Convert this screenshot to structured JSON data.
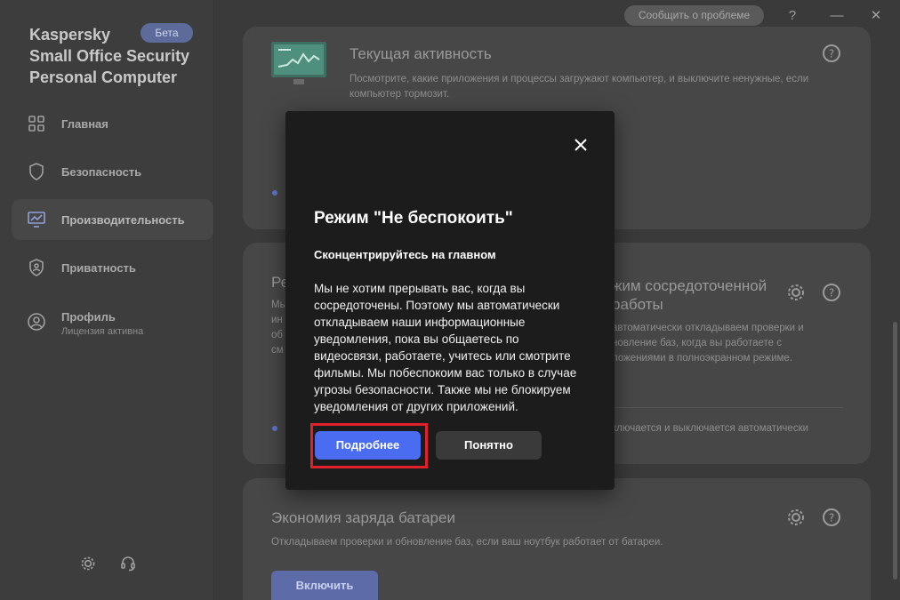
{
  "app": {
    "title": "Kaspersky\nSmall Office Security\nPersonal Computer",
    "badge": "Бета"
  },
  "sidebar": {
    "items": [
      {
        "label": "Главная",
        "icon": "home-grid-icon"
      },
      {
        "label": "Безопасность",
        "icon": "shield-icon"
      },
      {
        "label": "Производительность",
        "icon": "monitor-performance-icon"
      },
      {
        "label": "Приватность",
        "icon": "privacy-shield-icon"
      },
      {
        "label": "Профиль",
        "sublabel": "Лицензия активна",
        "icon": "profile-icon"
      }
    ],
    "bottom_icons": [
      "gear-icon",
      "headset-icon"
    ]
  },
  "topbar": {
    "report_label": "Сообщить о проблеме",
    "help": "?",
    "minimize": "—",
    "close": "✕"
  },
  "cards": {
    "activity": {
      "title": "Текущая активность",
      "desc": "Посмотрите, какие приложения и процессы загружают компьютер, и выключите ненужные, если компьютер тормозит."
    },
    "focus": {
      "title_left": "Ре",
      "title_right": "жим сосредоточенной\nработы",
      "desc_left": "Мы\nин\nоб\nсм",
      "desc_right": "автоматически откладываем проверки и\nновление баз, когда вы работаете с\nложениями в полноэкранном режиме.",
      "status_right": "ключается и выключается автоматически"
    },
    "battery": {
      "title": "Экономия заряда батареи",
      "desc": "Откладываем проверки и обновление баз, если ваш ноутбук работает от батареи.",
      "button": "Включить"
    }
  },
  "dialog": {
    "title": "Режим \"Не беспокоить\"",
    "subtitle": "Сконцентрируйтесь на главном",
    "body": "Мы не хотим прерывать вас, когда вы сосредоточены. Поэтому мы автоматически откладываем наши информационные уведомления, пока вы общаетесь по видеосвязи, работаете, учитесь или смотрите фильмы. Мы побеспокоим вас только в случае угрозы безопасности. Также мы не блокируем уведомления от других приложений.",
    "btn_more": "Подробнее",
    "btn_ok": "Понятно"
  },
  "colors": {
    "accent": "#4a6cf0",
    "highlight": "#e0202a",
    "dialog_bg": "#1c1c1c"
  }
}
